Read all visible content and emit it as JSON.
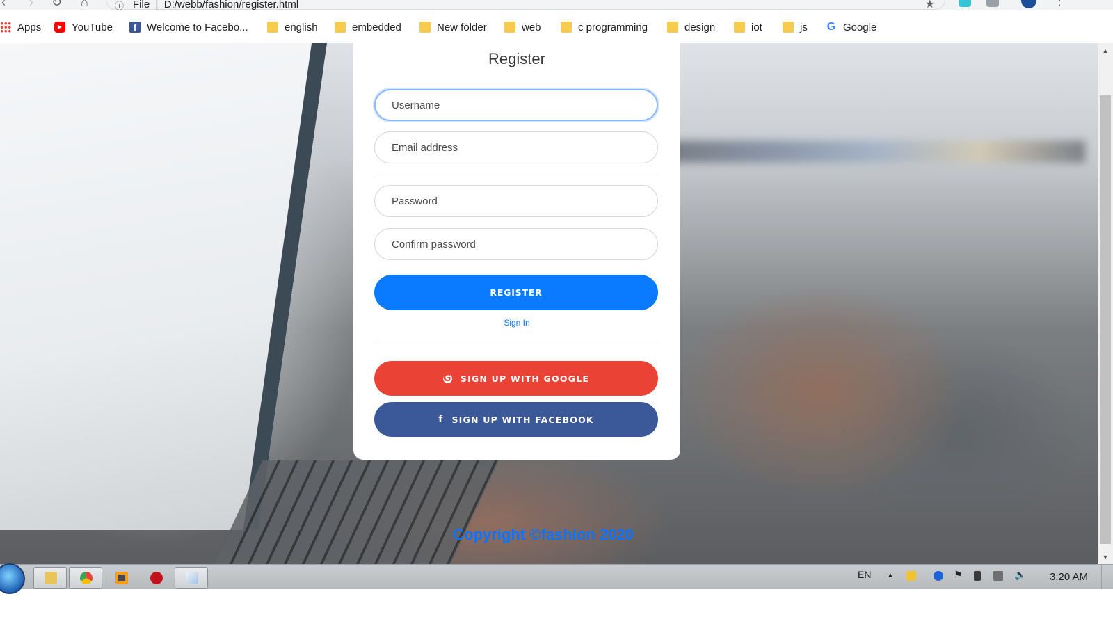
{
  "browser": {
    "address_url": "D:/webb/fashion/register.html",
    "address_prefix": "File",
    "bookmarks": [
      {
        "label": "Apps",
        "icon": "apps-grid-icon"
      },
      {
        "label": "YouTube",
        "icon": "youtube-icon"
      },
      {
        "label": "Welcome to Facebo...",
        "icon": "facebook-icon"
      },
      {
        "label": "english",
        "icon": "folder-icon"
      },
      {
        "label": "embedded",
        "icon": "folder-icon"
      },
      {
        "label": "New folder",
        "icon": "folder-icon"
      },
      {
        "label": "web",
        "icon": "folder-icon"
      },
      {
        "label": "c programming",
        "icon": "folder-icon"
      },
      {
        "label": "design",
        "icon": "folder-icon"
      },
      {
        "label": "iot",
        "icon": "folder-icon"
      },
      {
        "label": "js",
        "icon": "folder-icon"
      },
      {
        "label": "Google",
        "icon": "google-icon"
      }
    ]
  },
  "register_form": {
    "title": "Register",
    "username_placeholder": "Username",
    "email_placeholder": "Email address",
    "password_placeholder": "Password",
    "confirm_password_placeholder": "Confirm password",
    "register_button": "REGISTER",
    "signin_link": "Sign In",
    "google_button": "SIGN UP WITH GOOGLE",
    "facebook_button": "SIGN UP WITH FACEBOOK"
  },
  "footer": {
    "copyright": "Copyright ©fashion 2020"
  },
  "taskbar": {
    "language": "EN",
    "clock": "3:20 AM"
  },
  "colors": {
    "register_blue": "#0a7bff",
    "google_red": "#ea4335",
    "facebook_blue": "#3b5998",
    "copyright_blue": "#0b73ff"
  }
}
